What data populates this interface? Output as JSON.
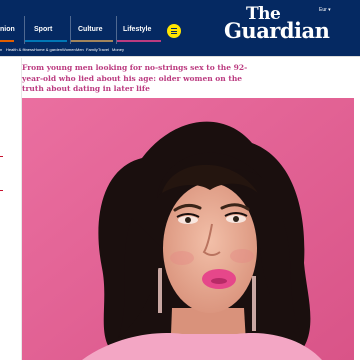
{
  "masthead": {
    "edition": "Eur",
    "logo_the": "The",
    "logo_guardian": "Guardian",
    "pillars": [
      {
        "label": "nion"
      },
      {
        "label": "Sport"
      },
      {
        "label": "Culture"
      },
      {
        "label": "Lifestyle"
      }
    ],
    "subnav": [
      "n",
      "Health & fitness",
      "Home & garden",
      "Women",
      "Men",
      "Family",
      "Travel",
      "Money"
    ]
  },
  "article": {
    "headline": "From young men looking for no-strings sex to the 92-year-old who lied about his age: older women on the truth about dating in later life"
  },
  "colors": {
    "brand": "#052962",
    "lifestyle": "#bb3b80",
    "menu": "#ffe500",
    "hero_background": "#e06595"
  }
}
